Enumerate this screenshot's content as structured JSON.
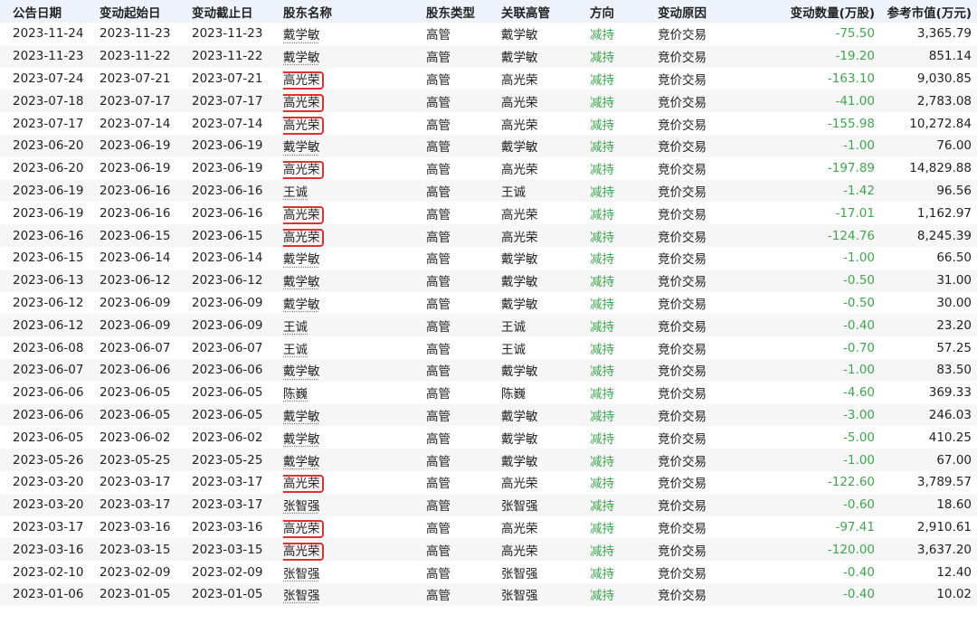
{
  "headers": [
    "公告日期",
    "变动起始日",
    "变动截止日",
    "股东名称",
    "股东类型",
    "关联高管",
    "方向",
    "变动原因",
    "变动数量(万股)",
    "参考市值(万元)"
  ],
  "rows": [
    {
      "date": "2023-11-24",
      "start": "2023-11-23",
      "end": "2023-11-23",
      "holder": "戴学敏",
      "type": "高管",
      "exec": "戴学敏",
      "direction": "减持",
      "reason": "竞价交易",
      "change": "-75.50",
      "value": "3,365.79",
      "highlight": false
    },
    {
      "date": "2023-11-23",
      "start": "2023-11-22",
      "end": "2023-11-22",
      "holder": "戴学敏",
      "type": "高管",
      "exec": "戴学敏",
      "direction": "减持",
      "reason": "竞价交易",
      "change": "-19.20",
      "value": "851.14",
      "highlight": false
    },
    {
      "date": "2023-07-24",
      "start": "2023-07-21",
      "end": "2023-07-21",
      "holder": "高光荣",
      "type": "高管",
      "exec": "高光荣",
      "direction": "减持",
      "reason": "竞价交易",
      "change": "-163.10",
      "value": "9,030.85",
      "highlight": true
    },
    {
      "date": "2023-07-18",
      "start": "2023-07-17",
      "end": "2023-07-17",
      "holder": "高光荣",
      "type": "高管",
      "exec": "高光荣",
      "direction": "减持",
      "reason": "竞价交易",
      "change": "-41.00",
      "value": "2,783.08",
      "highlight": true
    },
    {
      "date": "2023-07-17",
      "start": "2023-07-14",
      "end": "2023-07-14",
      "holder": "高光荣",
      "type": "高管",
      "exec": "高光荣",
      "direction": "减持",
      "reason": "竞价交易",
      "change": "-155.98",
      "value": "10,272.84",
      "highlight": true
    },
    {
      "date": "2023-06-20",
      "start": "2023-06-19",
      "end": "2023-06-19",
      "holder": "戴学敏",
      "type": "高管",
      "exec": "戴学敏",
      "direction": "减持",
      "reason": "竞价交易",
      "change": "-1.00",
      "value": "76.00",
      "highlight": false
    },
    {
      "date": "2023-06-20",
      "start": "2023-06-19",
      "end": "2023-06-19",
      "holder": "高光荣",
      "type": "高管",
      "exec": "高光荣",
      "direction": "减持",
      "reason": "竞价交易",
      "change": "-197.89",
      "value": "14,829.88",
      "highlight": true
    },
    {
      "date": "2023-06-19",
      "start": "2023-06-16",
      "end": "2023-06-16",
      "holder": "王诚",
      "type": "高管",
      "exec": "王诚",
      "direction": "减持",
      "reason": "竞价交易",
      "change": "-1.42",
      "value": "96.56",
      "highlight": false
    },
    {
      "date": "2023-06-19",
      "start": "2023-06-16",
      "end": "2023-06-16",
      "holder": "高光荣",
      "type": "高管",
      "exec": "高光荣",
      "direction": "减持",
      "reason": "竞价交易",
      "change": "-17.01",
      "value": "1,162.97",
      "highlight": true
    },
    {
      "date": "2023-06-16",
      "start": "2023-06-15",
      "end": "2023-06-15",
      "holder": "高光荣",
      "type": "高管",
      "exec": "高光荣",
      "direction": "减持",
      "reason": "竞价交易",
      "change": "-124.76",
      "value": "8,245.39",
      "highlight": true
    },
    {
      "date": "2023-06-15",
      "start": "2023-06-14",
      "end": "2023-06-14",
      "holder": "戴学敏",
      "type": "高管",
      "exec": "戴学敏",
      "direction": "减持",
      "reason": "竞价交易",
      "change": "-1.00",
      "value": "66.50",
      "highlight": false
    },
    {
      "date": "2023-06-13",
      "start": "2023-06-12",
      "end": "2023-06-12",
      "holder": "戴学敏",
      "type": "高管",
      "exec": "戴学敏",
      "direction": "减持",
      "reason": "竞价交易",
      "change": "-0.50",
      "value": "31.00",
      "highlight": false
    },
    {
      "date": "2023-06-12",
      "start": "2023-06-09",
      "end": "2023-06-09",
      "holder": "戴学敏",
      "type": "高管",
      "exec": "戴学敏",
      "direction": "减持",
      "reason": "竞价交易",
      "change": "-0.50",
      "value": "30.00",
      "highlight": false
    },
    {
      "date": "2023-06-12",
      "start": "2023-06-09",
      "end": "2023-06-09",
      "holder": "王诚",
      "type": "高管",
      "exec": "王诚",
      "direction": "减持",
      "reason": "竞价交易",
      "change": "-0.40",
      "value": "23.20",
      "highlight": false
    },
    {
      "date": "2023-06-08",
      "start": "2023-06-07",
      "end": "2023-06-07",
      "holder": "王诚",
      "type": "高管",
      "exec": "王诚",
      "direction": "减持",
      "reason": "竞价交易",
      "change": "-0.70",
      "value": "57.25",
      "highlight": false
    },
    {
      "date": "2023-06-07",
      "start": "2023-06-06",
      "end": "2023-06-06",
      "holder": "戴学敏",
      "type": "高管",
      "exec": "戴学敏",
      "direction": "减持",
      "reason": "竞价交易",
      "change": "-1.00",
      "value": "83.50",
      "highlight": false
    },
    {
      "date": "2023-06-06",
      "start": "2023-06-05",
      "end": "2023-06-05",
      "holder": "陈巍",
      "type": "高管",
      "exec": "陈巍",
      "direction": "减持",
      "reason": "竞价交易",
      "change": "-4.60",
      "value": "369.33",
      "highlight": false
    },
    {
      "date": "2023-06-06",
      "start": "2023-06-05",
      "end": "2023-06-05",
      "holder": "戴学敏",
      "type": "高管",
      "exec": "戴学敏",
      "direction": "减持",
      "reason": "竞价交易",
      "change": "-3.00",
      "value": "246.03",
      "highlight": false
    },
    {
      "date": "2023-06-05",
      "start": "2023-06-02",
      "end": "2023-06-02",
      "holder": "戴学敏",
      "type": "高管",
      "exec": "戴学敏",
      "direction": "减持",
      "reason": "竞价交易",
      "change": "-5.00",
      "value": "410.25",
      "highlight": false
    },
    {
      "date": "2023-05-26",
      "start": "2023-05-25",
      "end": "2023-05-25",
      "holder": "戴学敏",
      "type": "高管",
      "exec": "戴学敏",
      "direction": "减持",
      "reason": "竞价交易",
      "change": "-1.00",
      "value": "67.00",
      "highlight": false
    },
    {
      "date": "2023-03-20",
      "start": "2023-03-17",
      "end": "2023-03-17",
      "holder": "高光荣",
      "type": "高管",
      "exec": "高光荣",
      "direction": "减持",
      "reason": "竞价交易",
      "change": "-122.60",
      "value": "3,789.57",
      "highlight": true
    },
    {
      "date": "2023-03-20",
      "start": "2023-03-17",
      "end": "2023-03-17",
      "holder": "张智强",
      "type": "高管",
      "exec": "张智强",
      "direction": "减持",
      "reason": "竞价交易",
      "change": "-0.60",
      "value": "18.60",
      "highlight": false
    },
    {
      "date": "2023-03-17",
      "start": "2023-03-16",
      "end": "2023-03-16",
      "holder": "高光荣",
      "type": "高管",
      "exec": "高光荣",
      "direction": "减持",
      "reason": "竞价交易",
      "change": "-97.41",
      "value": "2,910.61",
      "highlight": true
    },
    {
      "date": "2023-03-16",
      "start": "2023-03-15",
      "end": "2023-03-15",
      "holder": "高光荣",
      "type": "高管",
      "exec": "高光荣",
      "direction": "减持",
      "reason": "竞价交易",
      "change": "-120.00",
      "value": "3,637.20",
      "highlight": true
    },
    {
      "date": "2023-02-10",
      "start": "2023-02-09",
      "end": "2023-02-09",
      "holder": "张智强",
      "type": "高管",
      "exec": "张智强",
      "direction": "减持",
      "reason": "竞价交易",
      "change": "-0.40",
      "value": "12.40",
      "highlight": false
    },
    {
      "date": "2023-01-06",
      "start": "2023-01-05",
      "end": "2023-01-05",
      "holder": "张智强",
      "type": "高管",
      "exec": "张智强",
      "direction": "减持",
      "reason": "竞价交易",
      "change": "-0.40",
      "value": "10.02",
      "highlight": false
    }
  ]
}
